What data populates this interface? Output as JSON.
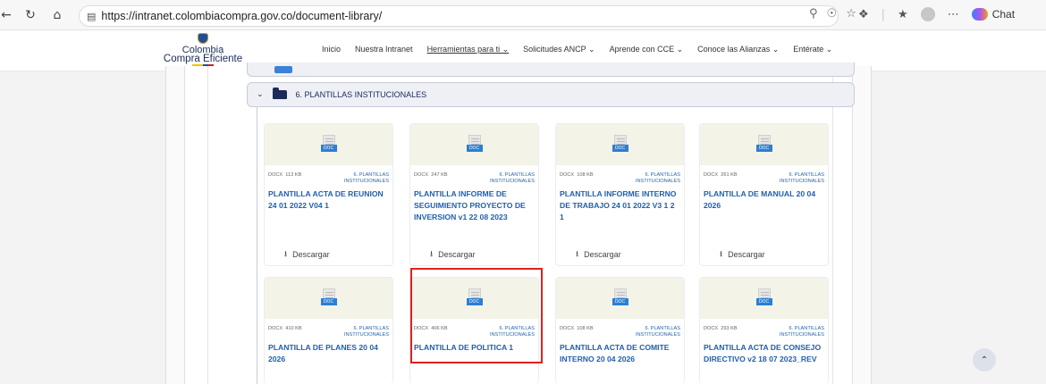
{
  "browser": {
    "url": "https://intranet.colombiacompra.gov.co/document-library/",
    "copilot_label": "Chat"
  },
  "site": {
    "brand_line1": "Colombia",
    "brand_line2": "Compra Eficiente",
    "menu": [
      {
        "label": "Inicio"
      },
      {
        "label": "Nuestra Intranet"
      },
      {
        "label": "Herramientas para ti ⌄"
      },
      {
        "label": "Solicitudes ANCP ⌄"
      },
      {
        "label": "Aprende con CCE ⌄"
      },
      {
        "label": "Conoce las Alianzas ⌄"
      },
      {
        "label": "Entérate ⌄"
      }
    ]
  },
  "section": {
    "title": "6. PLANTILLAS INSTITUCIONALES"
  },
  "download_label": "Descargar",
  "doc_tag": "DOC",
  "cards": [
    {
      "type": "DOCX",
      "size": "113 KB",
      "category": "6. PLANTILLAS INSTITUCIONALES",
      "name": "PLANTILLA ACTA DE REUNION 24 01 2022 V04 1"
    },
    {
      "type": "DOCX",
      "size": "247 KB",
      "category": "6. PLANTILLAS INSTITUCIONALES",
      "name": "PLANTILLA INFORME DE SEGUIMIENTO PROYECTO DE INVERSION v1 22 08 2023"
    },
    {
      "type": "DOCX",
      "size": "108 KB",
      "category": "6. PLANTILLAS INSTITUCIONALES",
      "name": "PLANTILLA INFORME INTERNO DE TRABAJO 24 01 2022 V3 1 2 1"
    },
    {
      "type": "DOCX",
      "size": "261 KB",
      "category": "6. PLANTILLAS INSTITUCIONALES",
      "name": "PLANTILLA DE MANUAL 20 04 2026"
    },
    {
      "type": "DOCX",
      "size": "410 KB",
      "category": "6. PLANTILLAS INSTITUCIONALES",
      "name": "PLANTILLA DE PLANES 20 04 2026"
    },
    {
      "type": "DOCX",
      "size": "406 KB",
      "category": "6. PLANTILLAS INSTITUCIONALES",
      "name": "PLANTILLA DE POLITICA 1"
    },
    {
      "type": "DOCX",
      "size": "108 KB",
      "category": "6. PLANTILLAS INSTITUCIONALES",
      "name": "PLANTILLA ACTA DE COMITE INTERNO 20 04 2026"
    },
    {
      "type": "DOCX",
      "size": "293 KB",
      "category": "6. PLANTILLAS INSTITUCIONALES",
      "name": "PLANTILLA ACTA DE CONSEJO DIRECTIVO v2 18 07 2023_REV"
    }
  ],
  "colors": {
    "link_blue": "#1f5fae",
    "navy": "#1a2b5a",
    "highlight_red": "#e02020",
    "thumb_bg": "#f4f3e8"
  }
}
